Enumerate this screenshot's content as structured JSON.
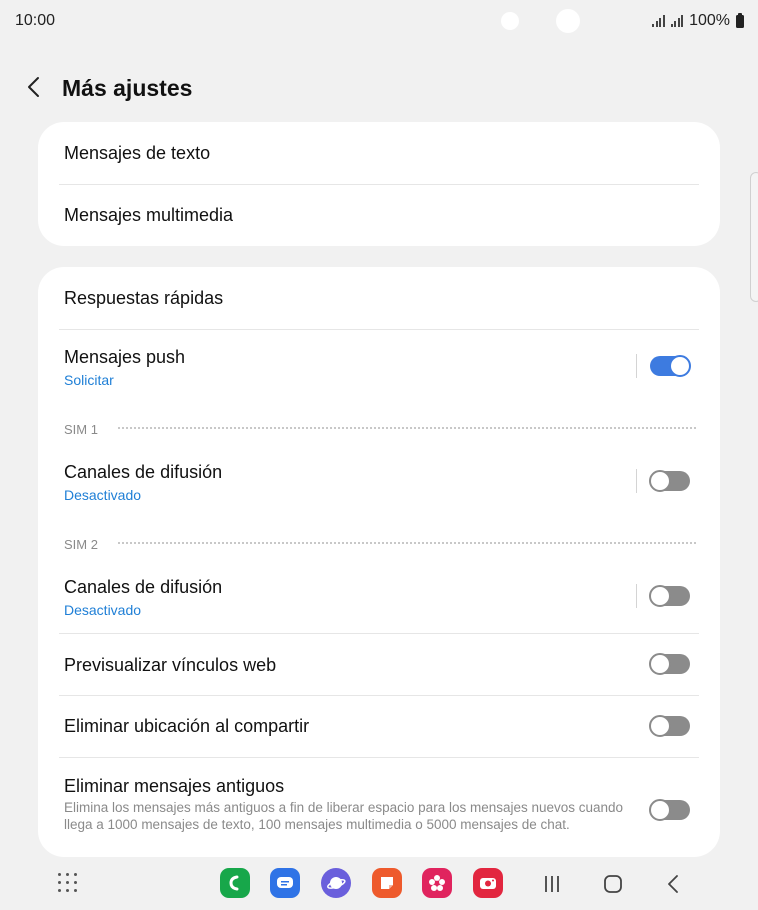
{
  "status_bar": {
    "time": "10:00",
    "battery": "100%"
  },
  "header": {
    "title": "Más ajustes"
  },
  "card1": {
    "rows": [
      {
        "title": "Mensajes de texto"
      },
      {
        "title": "Mensajes multimedia"
      }
    ]
  },
  "card2": {
    "quick_replies": {
      "title": "Respuestas rápidas"
    },
    "push": {
      "title": "Mensajes push",
      "subtitle": "Solicitar",
      "enabled": true
    },
    "sim1": {
      "label": "SIM 1",
      "title": "Canales de difusión",
      "subtitle": "Desactivado",
      "enabled": false
    },
    "sim2": {
      "label": "SIM 2",
      "title": "Canales de difusión",
      "subtitle": "Desactivado",
      "enabled": false
    },
    "link_preview": {
      "title": "Previsualizar vínculos web",
      "enabled": false
    },
    "remove_location": {
      "title": "Eliminar ubicación al compartir",
      "enabled": false
    },
    "delete_old": {
      "title": "Eliminar mensajes antiguos",
      "description": "Elimina los mensajes más antiguos a fin de liberar espacio para los mensajes nuevos cuando llega a 1000 mensajes de texto, 100 mensajes multimedia o 5000 mensajes de chat.",
      "enabled": false
    }
  },
  "colors": {
    "accent": "#3d7be0",
    "subtitle_blue": "#1f7fd6",
    "toggle_off": "#8b8b8b",
    "background": "#f1f1f1"
  },
  "navbar": {
    "apps": [
      {
        "name": "phone-app-icon",
        "color": "#17a74a"
      },
      {
        "name": "messages-app-icon",
        "color": "#2f73e6"
      },
      {
        "name": "internet-app-icon",
        "color": "#6a5fdc"
      },
      {
        "name": "notes-app-icon",
        "color": "#ee5a2c"
      },
      {
        "name": "gallery-app-icon",
        "color": "#e0245e"
      },
      {
        "name": "camera-app-icon",
        "color": "#e2263f"
      }
    ]
  }
}
